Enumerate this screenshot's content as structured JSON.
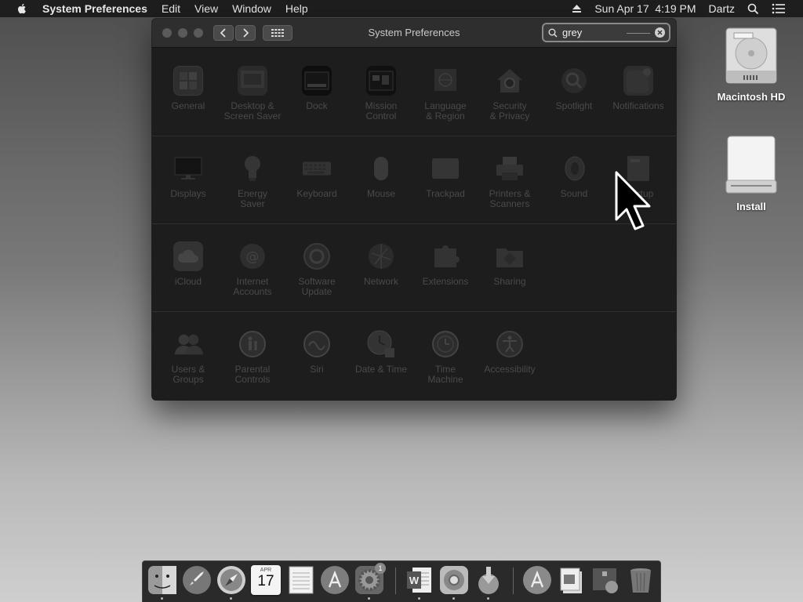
{
  "menubar": {
    "apple_icon": "apple-icon",
    "app_name": "System Preferences",
    "menus": [
      "Edit",
      "View",
      "Window",
      "Help"
    ],
    "datetime": "Sun Apr 17  4:19 PM",
    "user": "Dartz"
  },
  "window": {
    "title": "System Preferences",
    "search": {
      "value": "grey"
    }
  },
  "prefs": {
    "row1": [
      "General",
      "Desktop &\nScreen Saver",
      "Dock",
      "Mission\nControl",
      "Language\n& Region",
      "Security\n& Privacy",
      "Spotlight",
      "Notifications"
    ],
    "row2": [
      "Displays",
      "Energy\nSaver",
      "Keyboard",
      "Mouse",
      "Trackpad",
      "Printers &\nScanners",
      "Sound",
      "Startup\nDisk"
    ],
    "row3": [
      "iCloud",
      "Internet\nAccounts",
      "Software\nUpdate",
      "Network",
      "Extensions",
      "Sharing"
    ],
    "row4": [
      "Users &\nGroups",
      "Parental\nControls",
      "Siri",
      "Date & Time",
      "Time\nMachine",
      "Accessibility"
    ]
  },
  "desktop": {
    "items": [
      "Macintosh HD",
      "Install"
    ]
  },
  "dock": {
    "calendar_month": "APR",
    "calendar_day": "17",
    "update_badge": "1"
  },
  "colors": {
    "menubar_bg": "#1e1e1e",
    "window_bg": "#1d1d1d",
    "dimmed_label": "#4a4a4a"
  }
}
